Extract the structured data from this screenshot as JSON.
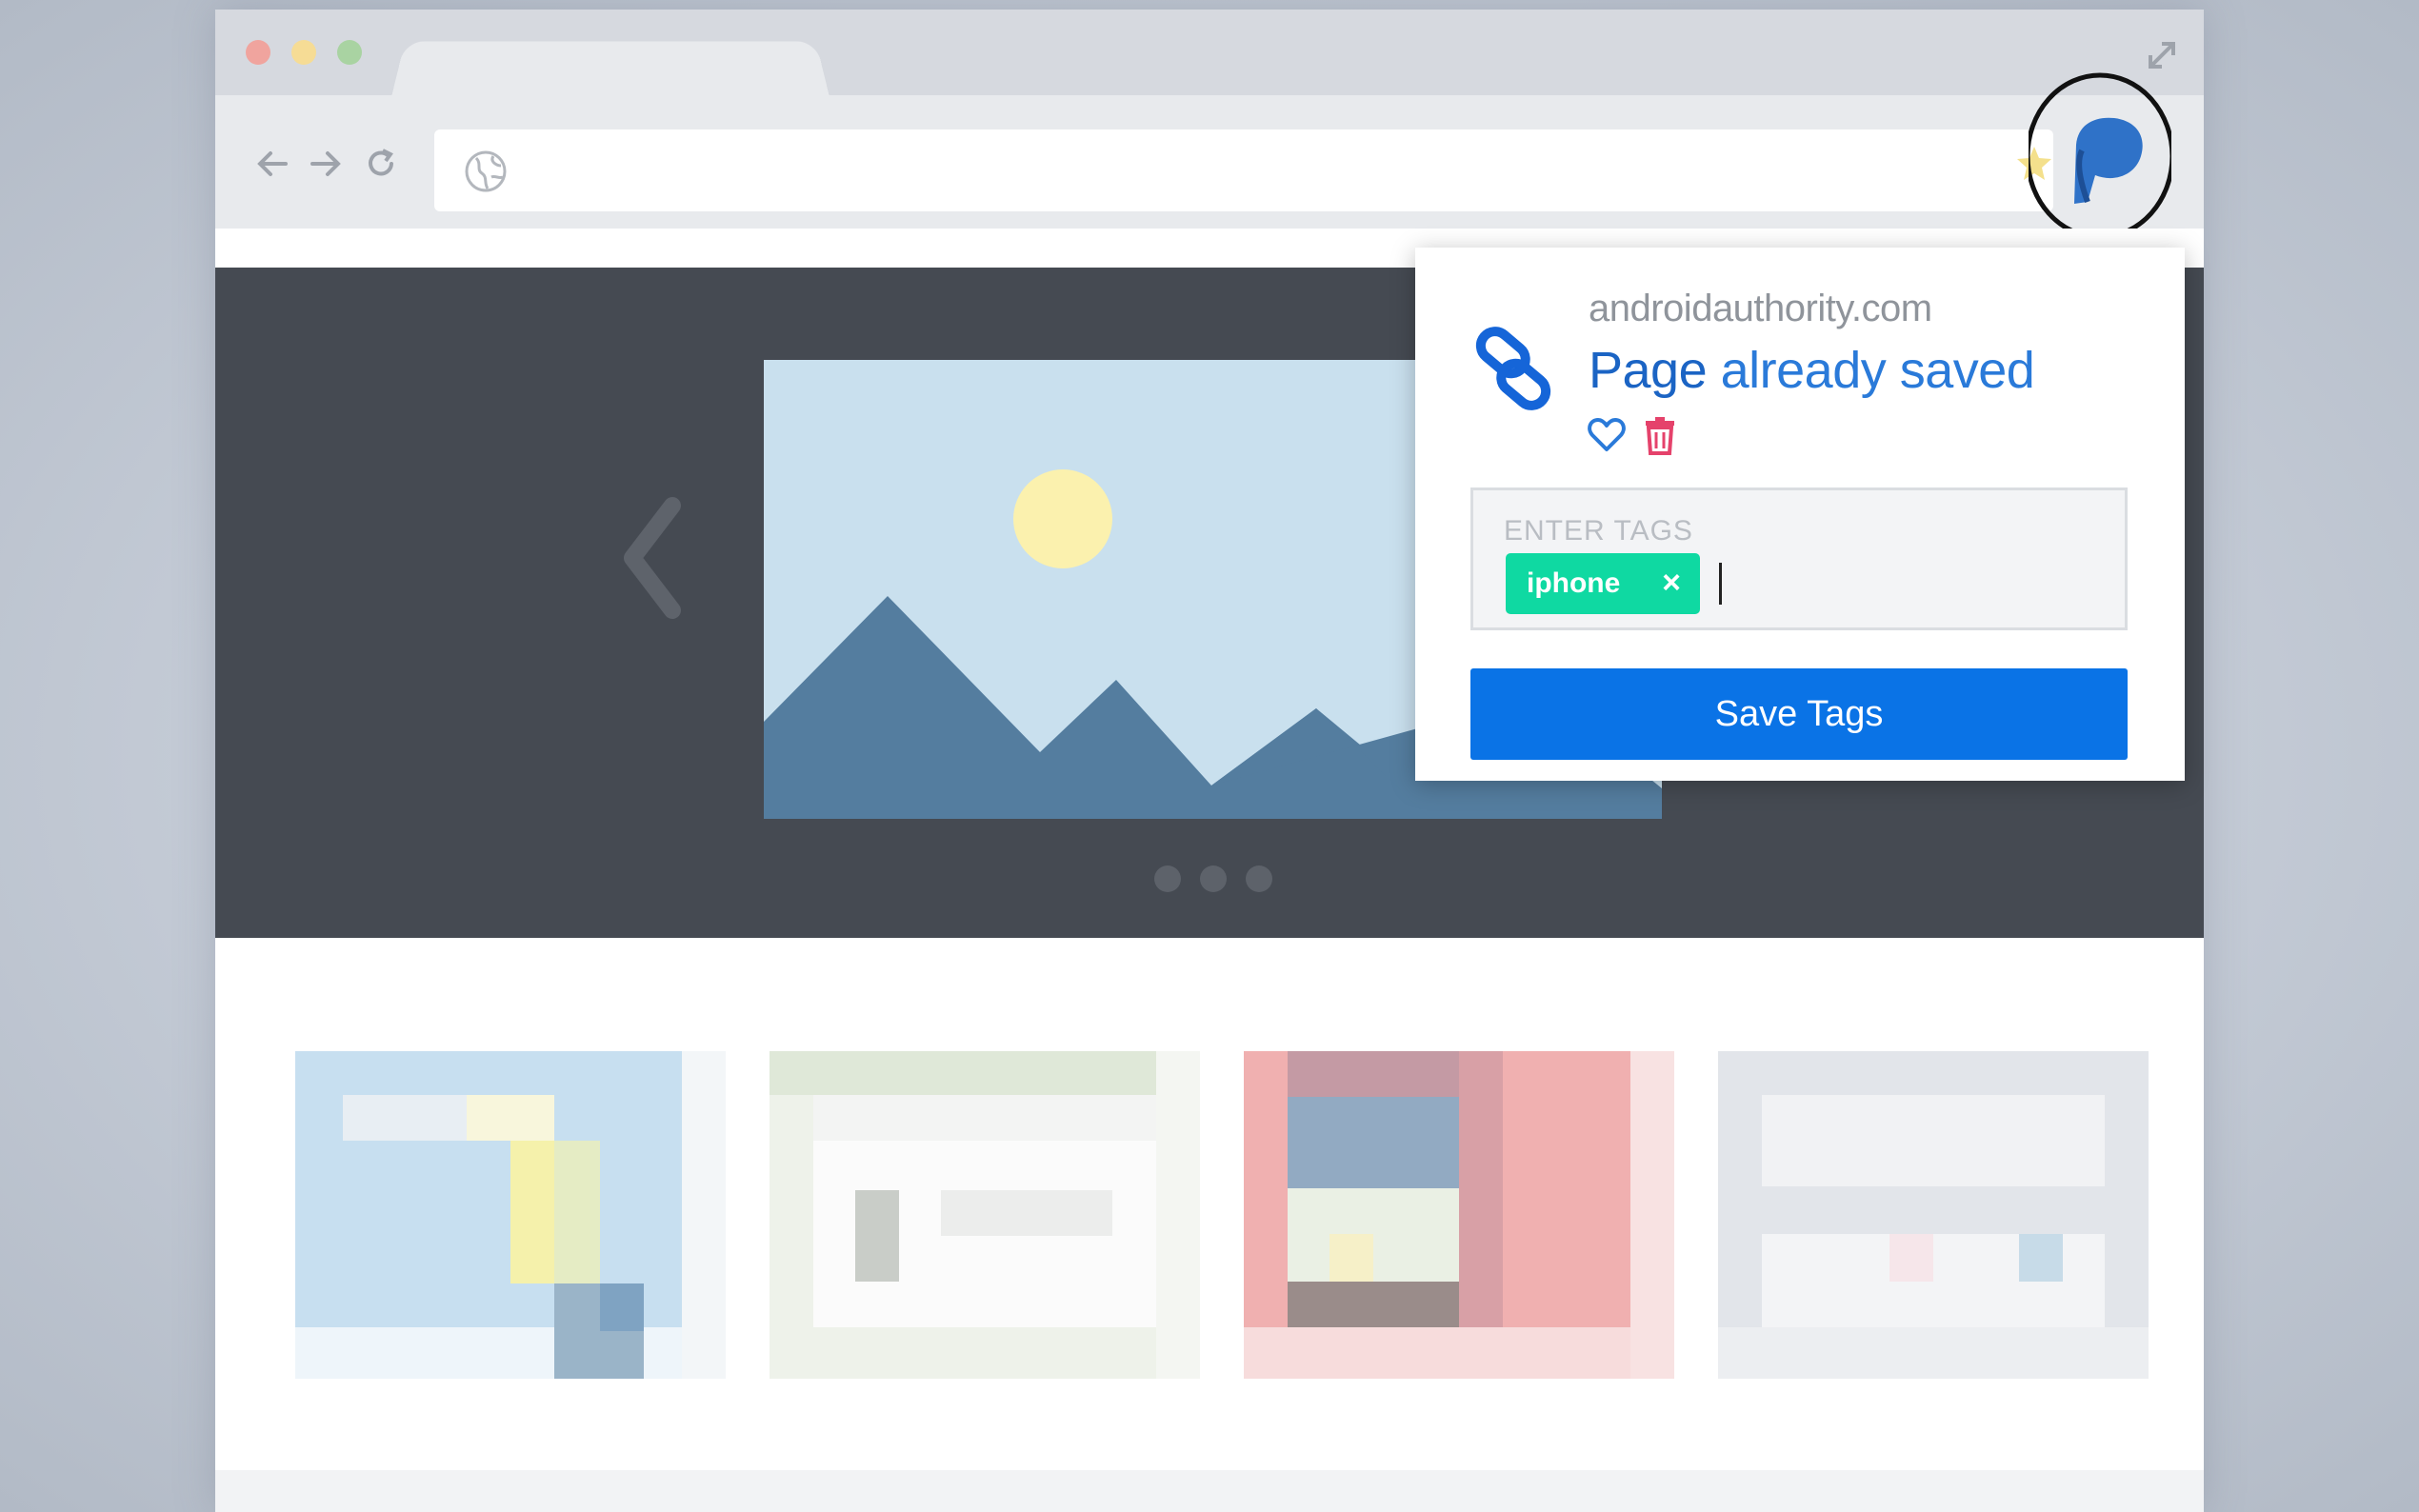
{
  "browser": {
    "window_controls": [
      "close",
      "minimize",
      "maximize"
    ],
    "icons": {
      "back": "arrow-left-icon",
      "forward": "arrow-right-icon",
      "reload": "reload-icon",
      "globe": "globe-icon",
      "bookmark": "star-icon",
      "expand": "expand-icon",
      "extension": "pocket-p-icon"
    },
    "address": ""
  },
  "popup": {
    "domain": "androidauthority.com",
    "status_word_1": "Page",
    "status_rest": " already saved",
    "tags_label": "ENTER TAGS",
    "tags": [
      {
        "label": "iphone",
        "remove": "×"
      }
    ],
    "input_value": "",
    "save_button": "Save Tags"
  },
  "colors": {
    "accent": "#0a73e6",
    "status_text": "#2a7ad9",
    "tag_chip": "#0fd9a2",
    "trash": "#e5426b",
    "hero_bg": "#454a52"
  }
}
